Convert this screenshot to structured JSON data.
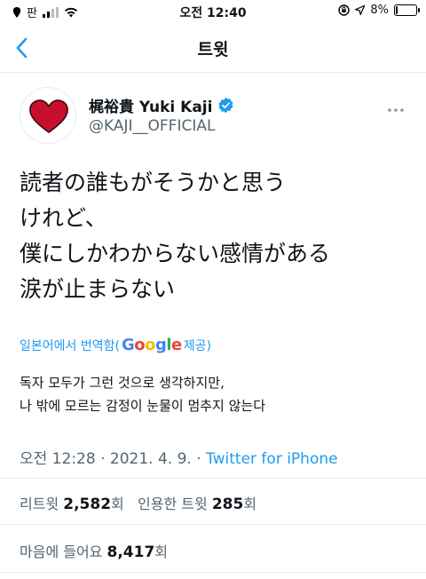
{
  "status_bar": {
    "carrier": "판",
    "time": "오전 12:40",
    "battery_text": "8%",
    "battery_level": 0.08
  },
  "nav": {
    "title": "트윗"
  },
  "tweet": {
    "display_name": "梶裕貴 Yuki Kaji",
    "handle": "@KAJI__OFFICIAL",
    "text_lines": [
      "読者の誰もがそうかと思う",
      "けれど、",
      "僕にしかわからない感情がある",
      "涙が止まらない"
    ],
    "translate": {
      "prefix": "일본어에서 번역함(",
      "google_letters": [
        "G",
        "o",
        "o",
        "g",
        "l",
        "e"
      ],
      "suffix": " 제공)"
    },
    "translated_lines": [
      "독자 모두가 그런 것으로 생각하지만,",
      " 나 밖에 모르는 감정이 눈물이 멈추지 않는다"
    ],
    "meta": {
      "time": "오전 12:28",
      "sep1": " · ",
      "date": "2021. 4. 9.",
      "sep2": " · ",
      "source": "Twitter for iPhone"
    },
    "stats": {
      "retweets_label": "리트윗 ",
      "retweets_count": "2,582",
      "retweets_unit": "회",
      "quotes_label": "인용한 트윗 ",
      "quotes_count": "285",
      "quotes_unit": "회",
      "likes_label": "마음에 들어요 ",
      "likes_count": "8,417",
      "likes_unit": "회"
    }
  },
  "colors": {
    "accent": "#1d9bf0",
    "heart": "#c8102e",
    "muted": "#536471"
  }
}
